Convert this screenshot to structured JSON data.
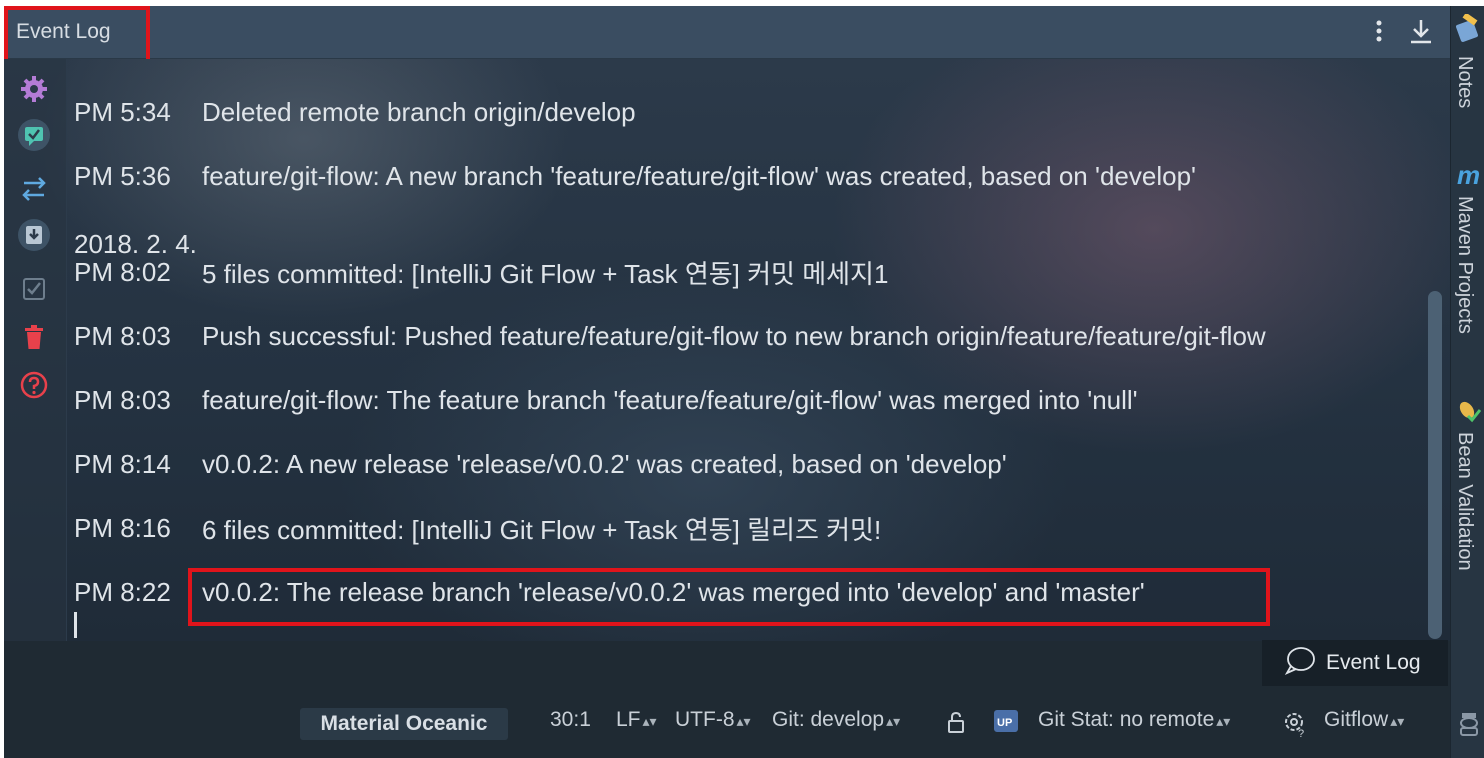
{
  "header": {
    "title": "Event Log"
  },
  "log": {
    "entries": [
      {
        "time": "PM 5:34",
        "message": "Deleted remote branch origin/develop"
      },
      {
        "time": "PM 5:36",
        "message": "feature/git-flow: A new branch 'feature/feature/git-flow' was created, based on 'develop'"
      },
      {
        "time": "PM 8:02",
        "message": "5 files committed: [IntelliJ Git Flow + Task 연동] 커밋 메세지1"
      },
      {
        "time": "PM 8:03",
        "message": "Push successful: Pushed feature/feature/git-flow to new branch origin/feature/feature/git-flow"
      },
      {
        "time": "PM 8:03",
        "message": "feature/git-flow: The feature branch 'feature/feature/git-flow' was merged into 'null'"
      },
      {
        "time": "PM 8:14",
        "message": "v0.0.2: A new release 'release/v0.0.2' was created, based on 'develop'"
      },
      {
        "time": "PM 8:16",
        "message": "6 files committed: [IntelliJ Git Flow + Task 연동] 릴리즈 커밋!"
      },
      {
        "time": "PM 8:22",
        "message": "v0.0.2: The release branch 'release/v0.0.2' was merged into 'develop' and 'master'"
      }
    ],
    "date_separator": "2018. 2. 4."
  },
  "right_sidebar": {
    "items": [
      {
        "label": "Notes",
        "icon": "notes-icon"
      },
      {
        "label": "Maven Projects",
        "icon": "maven-icon"
      },
      {
        "label": "Bean Validation",
        "icon": "bean-validation-icon"
      }
    ]
  },
  "tool_button": {
    "label": "Event Log"
  },
  "status_bar": {
    "theme": "Material Oceanic",
    "position": "30:1",
    "line_separator": "LF",
    "encoding": "UTF-8",
    "vcs": "Git: develop",
    "git_stat": "Git Stat: no remote",
    "gitflow": "Gitflow"
  },
  "colors": {
    "highlight": "#e0141b",
    "header_bg": "#3a4d61",
    "accent_purple": "#b47cd6",
    "accent_teal": "#4fc3b1",
    "accent_red": "#e8414b"
  }
}
